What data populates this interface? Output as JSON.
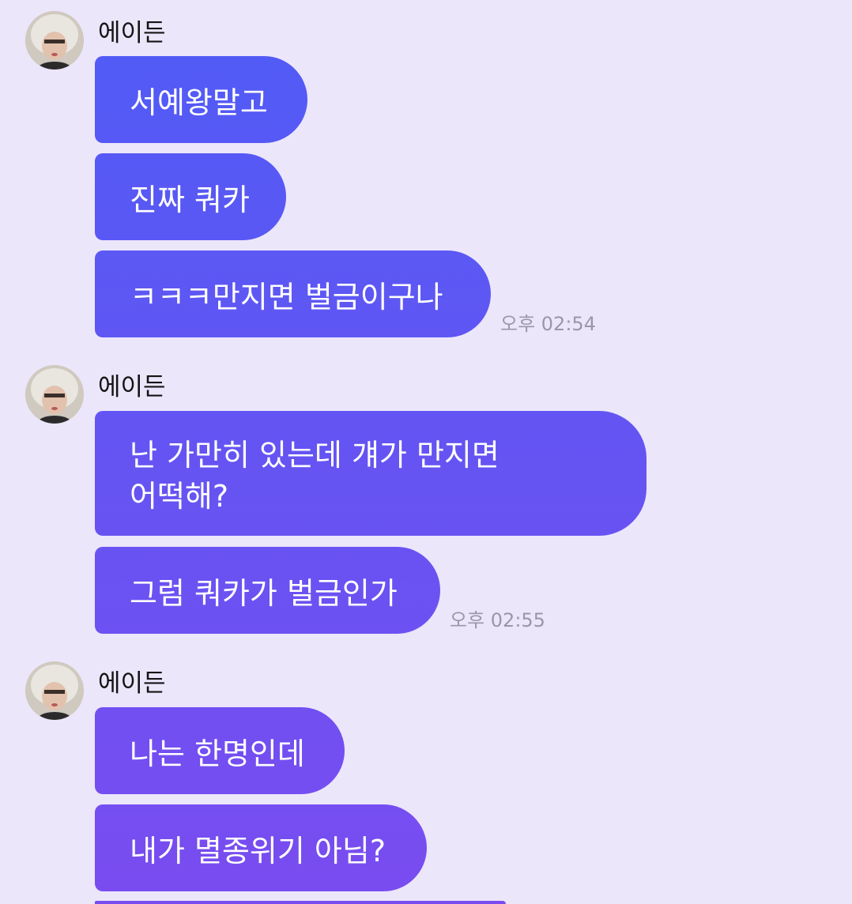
{
  "groups": [
    {
      "sender": "에이든",
      "messages": [
        "서예왕말고",
        "진짜 쿼카",
        "ㅋㅋㅋ만지면 벌금이구나"
      ],
      "time": "오후 02:54"
    },
    {
      "sender": "에이든",
      "messages": [
        "난 가만히 있는데 걔가 만지면\n어떡해?",
        "그럼 쿼카가 벌금인가"
      ],
      "time": "오후 02:55"
    },
    {
      "sender": "에이든",
      "messages": [
        "나는 한명인데",
        "내가 멸종위기 아님?"
      ]
    }
  ],
  "colors": {
    "background": "#ECE6FB",
    "bubble_gradient_start": "#4F5CF6",
    "bubble_gradient_end": "#7A4CF0",
    "bubble_text": "#FFFFFF",
    "time_text": "#9B97A6"
  }
}
